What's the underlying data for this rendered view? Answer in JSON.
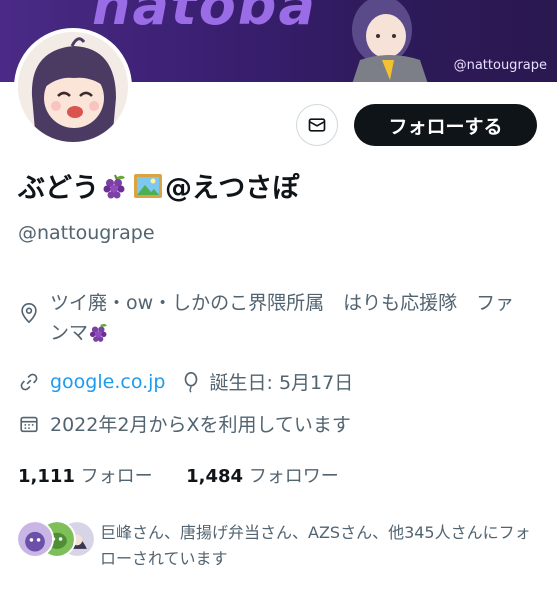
{
  "banner": {
    "word": "natoba",
    "watermark": "@nattougrape"
  },
  "profile": {
    "display_name_prefix": "ぶどう",
    "display_name_suffix": "@えつさぽ",
    "handle": "@nattougrape",
    "follow_label": "フォローする"
  },
  "bio": {
    "text": "ツイ廃・ow・しかのこ界隈所属　はりも応援隊　ファンマ"
  },
  "meta": {
    "website": "google.co.jp",
    "birthday": "誕生日: 5月17日",
    "joined": "2022年2月からXを利用しています"
  },
  "stats": {
    "following_count": "1,111",
    "following_label": "フォロー",
    "followers_count": "1,484",
    "followers_label": "フォロワー"
  },
  "followed_by": {
    "text": "巨峰さん、唐揚げ弁当さん、AZSさん、他345人さんにフォローされています"
  },
  "icons": {
    "location": "location-pin-icon",
    "link": "link-icon",
    "birthday": "balloon-icon",
    "calendar": "calendar-icon",
    "message": "envelope-icon"
  },
  "colors": {
    "accent": "#1d9bf0",
    "follow_button": "#0f1419",
    "secondary_text": "#536471",
    "banner": "#3a1f70"
  }
}
